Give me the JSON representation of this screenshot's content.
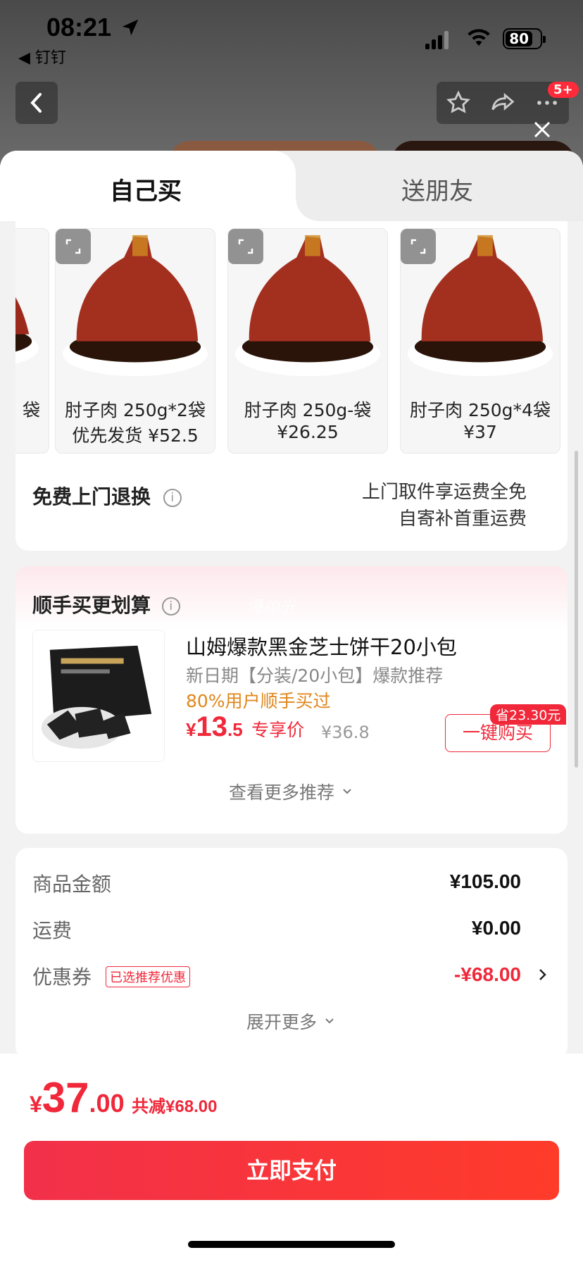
{
  "status": {
    "time": "08:21",
    "back_app": "◀ 钉钉",
    "battery": "80"
  },
  "nav": {
    "badge": "5+"
  },
  "tabs": [
    {
      "label": "自己买"
    },
    {
      "label": "送朋友"
    }
  ],
  "skus": [
    {
      "line1": "袋",
      "line2": ""
    },
    {
      "line1": "肘子肉 250g*2袋",
      "line2": "优先发货 ¥52.5"
    },
    {
      "line1": "肘子肉 250g-袋",
      "line2": "¥26.25"
    },
    {
      "line1": "肘子肉 250g*4袋",
      "line2": "¥37"
    }
  ],
  "return": {
    "title": "免费上门退换",
    "line1": "上门取件享运费全免",
    "line2": "自寄补首重运费"
  },
  "addon": {
    "title": "顺手买更划算",
    "watermark": "爆单光",
    "product_name": "山姆爆款黑金芝士饼干20小包",
    "subtitle": "新日期【分装/20小包】爆款推荐",
    "highlight": "80%用户顺手买过",
    "price_symbol": "¥",
    "price_int": "13",
    "price_dec": ".5",
    "price_label": "专享价",
    "original_price": "¥36.8",
    "save_badge": "省23.30元",
    "buy_button": "一键购买",
    "more": "查看更多推荐"
  },
  "summary": {
    "rows": [
      {
        "label": "商品金额",
        "value": "¥105.00"
      },
      {
        "label": "运费",
        "value": "¥0.00"
      }
    ],
    "coupon_label": "优惠券",
    "coupon_tag": "已选推荐优惠",
    "coupon_value": "-¥68.00",
    "expand": "展开更多"
  },
  "footer": {
    "symbol": "¥",
    "int": "37",
    "dec": ".00",
    "saved": "共减¥68.00",
    "pay": "立即支付"
  },
  "colors": {
    "accent": "#f0283a",
    "orange": "#e0861a"
  }
}
